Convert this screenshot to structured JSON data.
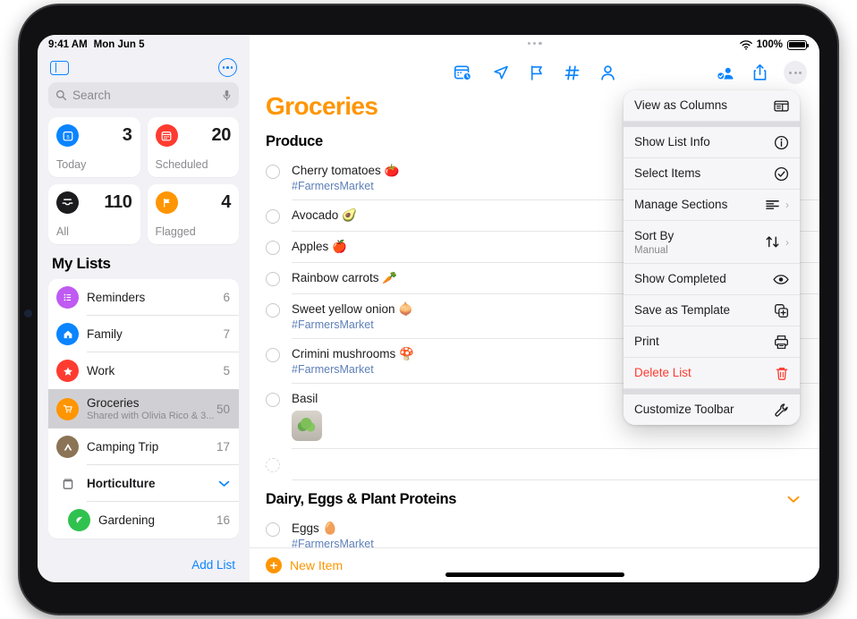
{
  "status_bar": {
    "time": "9:41 AM",
    "date": "Mon Jun 5",
    "wifi_icon": "wifi-icon",
    "battery_percent": "100%",
    "battery_icon": "battery-full-icon"
  },
  "sidebar": {
    "toggle_icon": "sidebar-toggle-icon",
    "more_icon": "ellipsis-circle-icon",
    "search": {
      "placeholder": "Search",
      "search_icon": "search-icon",
      "mic_icon": "microphone-icon"
    },
    "smart_lists": [
      {
        "label": "Today",
        "count": "3",
        "icon": "calendar-today-icon",
        "color": "#0a84ff"
      },
      {
        "label": "Scheduled",
        "count": "20",
        "icon": "calendar-scheduled-icon",
        "color": "#ff3b30"
      },
      {
        "label": "All",
        "count": "110",
        "icon": "all-inbox-icon",
        "color": "#1c1c1e"
      },
      {
        "label": "Flagged",
        "count": "4",
        "icon": "flag-icon",
        "color": "#ff9500"
      }
    ],
    "my_lists_title": "My Lists",
    "lists": [
      {
        "name": "Reminders",
        "count": "6",
        "icon": "bulleted-list-icon",
        "color": "#bf5af2",
        "type": "list"
      },
      {
        "name": "Family",
        "count": "7",
        "icon": "house-icon",
        "color": "#0a84ff",
        "type": "list"
      },
      {
        "name": "Work",
        "count": "5",
        "icon": "star-icon",
        "color": "#ff3b30",
        "type": "list"
      },
      {
        "name": "Groceries",
        "subtitle": "Shared with Olivia Rico & 3...",
        "count": "50",
        "icon": "shopping-cart-icon",
        "color": "#ff9500",
        "type": "list",
        "selected": true
      },
      {
        "name": "Camping Trip",
        "count": "17",
        "icon": "tent-icon",
        "color": "#8b7355",
        "type": "list"
      },
      {
        "name": "Horticulture",
        "count": "",
        "icon": "folder-icon",
        "color": "#6e6e73",
        "type": "folder",
        "chevron": "chevron-down-icon"
      },
      {
        "name": "Gardening",
        "count": "16",
        "icon": "leaf-icon",
        "color": "#30c24e",
        "type": "list",
        "nested": true
      }
    ],
    "add_list_label": "Add List"
  },
  "main": {
    "toolbar_center_icons": [
      "calendar-clock-icon",
      "location-arrow-icon",
      "flag-icon",
      "hashtag-icon",
      "person-icon"
    ],
    "toolbar_right_icons": [
      "share-person-icon",
      "share-icon",
      "more-ellipsis-icon"
    ],
    "list_title": "Groceries",
    "sections": [
      {
        "name": "Produce",
        "collapse_icon": "",
        "items": [
          {
            "title": "Cherry tomatoes 🍅",
            "tag": "#FarmersMarket"
          },
          {
            "title": "Avocado 🥑",
            "tag": ""
          },
          {
            "title": "Apples 🍎",
            "tag": ""
          },
          {
            "title": "Rainbow carrots 🥕",
            "tag": ""
          },
          {
            "title": "Sweet yellow onion 🧅",
            "tag": "#FarmersMarket"
          },
          {
            "title": "Crimini mushrooms 🍄",
            "tag": "#FarmersMarket"
          },
          {
            "title": "Basil",
            "tag": "",
            "attachment": "basil-photo-thumbnail"
          },
          {
            "title": "",
            "tag": "",
            "empty": true
          }
        ]
      },
      {
        "name": "Dairy, Eggs & Plant Proteins",
        "collapse_icon": "chevron-down-icon",
        "items": [
          {
            "title": "Eggs 🥚",
            "tag": "#FarmersMarket"
          }
        ]
      }
    ],
    "new_item_label": "New Item",
    "new_item_icon": "plus-circle-icon"
  },
  "context_menu": {
    "groups": [
      [
        {
          "label": "View as Columns",
          "icon": "columns-view-icon"
        }
      ],
      [
        {
          "label": "Show List Info",
          "icon": "info-circle-icon"
        },
        {
          "label": "Select Items",
          "icon": "checkmark-circle-icon"
        },
        {
          "label": "Manage Sections",
          "icon": "sections-list-icon",
          "submenu": true
        },
        {
          "label": "Sort By",
          "sublabel": "Manual",
          "icon": "sort-arrows-icon",
          "submenu": true
        },
        {
          "label": "Show Completed",
          "icon": "eye-icon"
        },
        {
          "label": "Save as Template",
          "icon": "duplicate-plus-icon"
        },
        {
          "label": "Print",
          "icon": "printer-icon"
        },
        {
          "label": "Delete List",
          "icon": "trash-icon",
          "danger": true
        }
      ],
      [
        {
          "label": "Customize Toolbar",
          "icon": "wrench-icon"
        }
      ]
    ]
  },
  "colors": {
    "accent_blue": "#0a84ff",
    "list_orange": "#ff9500",
    "danger_red": "#ff3b30",
    "tag_blue": "#5d7fb8"
  }
}
